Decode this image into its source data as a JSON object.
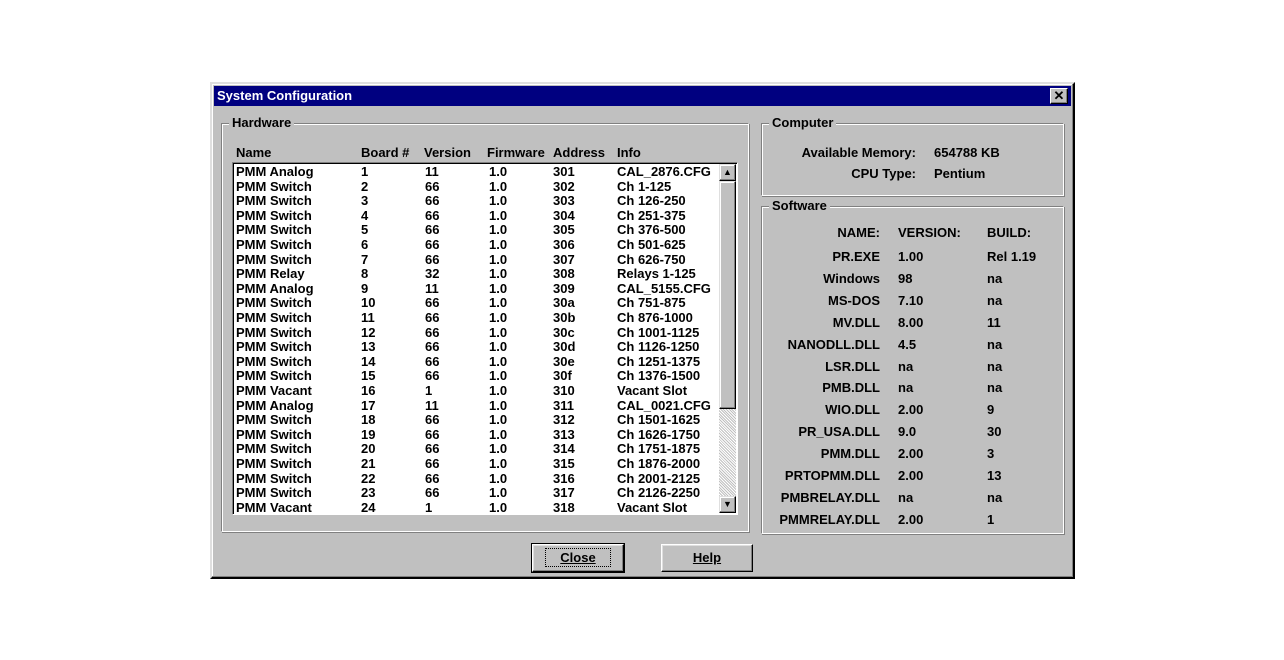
{
  "window": {
    "title": "System Configuration",
    "close_glyph": "✕"
  },
  "hardware": {
    "legend": "Hardware",
    "columns": [
      "Name",
      "Board #",
      "Version",
      "Firmware",
      "Address",
      "Info"
    ],
    "rows": [
      [
        "PMM Analog",
        "1",
        "11",
        "1.0",
        "301",
        "CAL_2876.CFG"
      ],
      [
        "PMM Switch",
        "2",
        "66",
        "1.0",
        "302",
        "Ch 1-125"
      ],
      [
        "PMM Switch",
        "3",
        "66",
        "1.0",
        "303",
        "Ch 126-250"
      ],
      [
        "PMM Switch",
        "4",
        "66",
        "1.0",
        "304",
        "Ch 251-375"
      ],
      [
        "PMM Switch",
        "5",
        "66",
        "1.0",
        "305",
        "Ch 376-500"
      ],
      [
        "PMM Switch",
        "6",
        "66",
        "1.0",
        "306",
        "Ch 501-625"
      ],
      [
        "PMM Switch",
        "7",
        "66",
        "1.0",
        "307",
        "Ch 626-750"
      ],
      [
        "PMM Relay",
        "8",
        "32",
        "1.0",
        "308",
        "Relays 1-125"
      ],
      [
        "PMM Analog",
        "9",
        "11",
        "1.0",
        "309",
        "CAL_5155.CFG"
      ],
      [
        "PMM Switch",
        "10",
        "66",
        "1.0",
        "30a",
        "Ch 751-875"
      ],
      [
        "PMM Switch",
        "11",
        "66",
        "1.0",
        "30b",
        "Ch 876-1000"
      ],
      [
        "PMM Switch",
        "12",
        "66",
        "1.0",
        "30c",
        "Ch 1001-1125"
      ],
      [
        "PMM Switch",
        "13",
        "66",
        "1.0",
        "30d",
        "Ch 1126-1250"
      ],
      [
        "PMM Switch",
        "14",
        "66",
        "1.0",
        "30e",
        "Ch 1251-1375"
      ],
      [
        "PMM Switch",
        "15",
        "66",
        "1.0",
        "30f",
        "Ch 1376-1500"
      ],
      [
        "PMM Vacant",
        "16",
        "1",
        "1.0",
        "310",
        "Vacant Slot"
      ],
      [
        "PMM Analog",
        "17",
        "11",
        "1.0",
        "311",
        "CAL_0021.CFG"
      ],
      [
        "PMM Switch",
        "18",
        "66",
        "1.0",
        "312",
        "Ch 1501-1625"
      ],
      [
        "PMM Switch",
        "19",
        "66",
        "1.0",
        "313",
        "Ch 1626-1750"
      ],
      [
        "PMM Switch",
        "20",
        "66",
        "1.0",
        "314",
        "Ch 1751-1875"
      ],
      [
        "PMM Switch",
        "21",
        "66",
        "1.0",
        "315",
        "Ch 1876-2000"
      ],
      [
        "PMM Switch",
        "22",
        "66",
        "1.0",
        "316",
        "Ch 2001-2125"
      ],
      [
        "PMM Switch",
        "23",
        "66",
        "1.0",
        "317",
        "Ch 2126-2250"
      ],
      [
        "PMM Vacant",
        "24",
        "1",
        "1.0",
        "318",
        "Vacant Slot"
      ]
    ]
  },
  "computer": {
    "legend": "Computer",
    "memory_label": "Available Memory:",
    "memory_value": "654788 KB",
    "cpu_label": "CPU Type:",
    "cpu_value": "Pentium"
  },
  "software": {
    "legend": "Software",
    "headers": [
      "NAME:",
      "VERSION:",
      "BUILD:"
    ],
    "rows": [
      [
        "PR.EXE",
        "1.00",
        "Rel 1.19"
      ],
      [
        "Windows",
        "98",
        "na"
      ],
      [
        "MS-DOS",
        "7.10",
        "na"
      ],
      [
        "MV.DLL",
        "8.00",
        "11"
      ],
      [
        "NANODLL.DLL",
        "4.5",
        "na"
      ],
      [
        "LSR.DLL",
        "na",
        "na"
      ],
      [
        "PMB.DLL",
        "na",
        "na"
      ],
      [
        "WIO.DLL",
        "2.00",
        "9"
      ],
      [
        "PR_USA.DLL",
        "9.0",
        "30"
      ],
      [
        "PMM.DLL",
        "2.00",
        "3"
      ],
      [
        "PRTOPMM.DLL",
        "2.00",
        "13"
      ],
      [
        "PMBRELAY.DLL",
        "na",
        "na"
      ],
      [
        "PMMRELAY.DLL",
        "2.00",
        "1"
      ]
    ]
  },
  "buttons": {
    "close": "Close",
    "help": "Help"
  },
  "scrollbar": {
    "up_glyph": "▲",
    "down_glyph": "▼"
  }
}
